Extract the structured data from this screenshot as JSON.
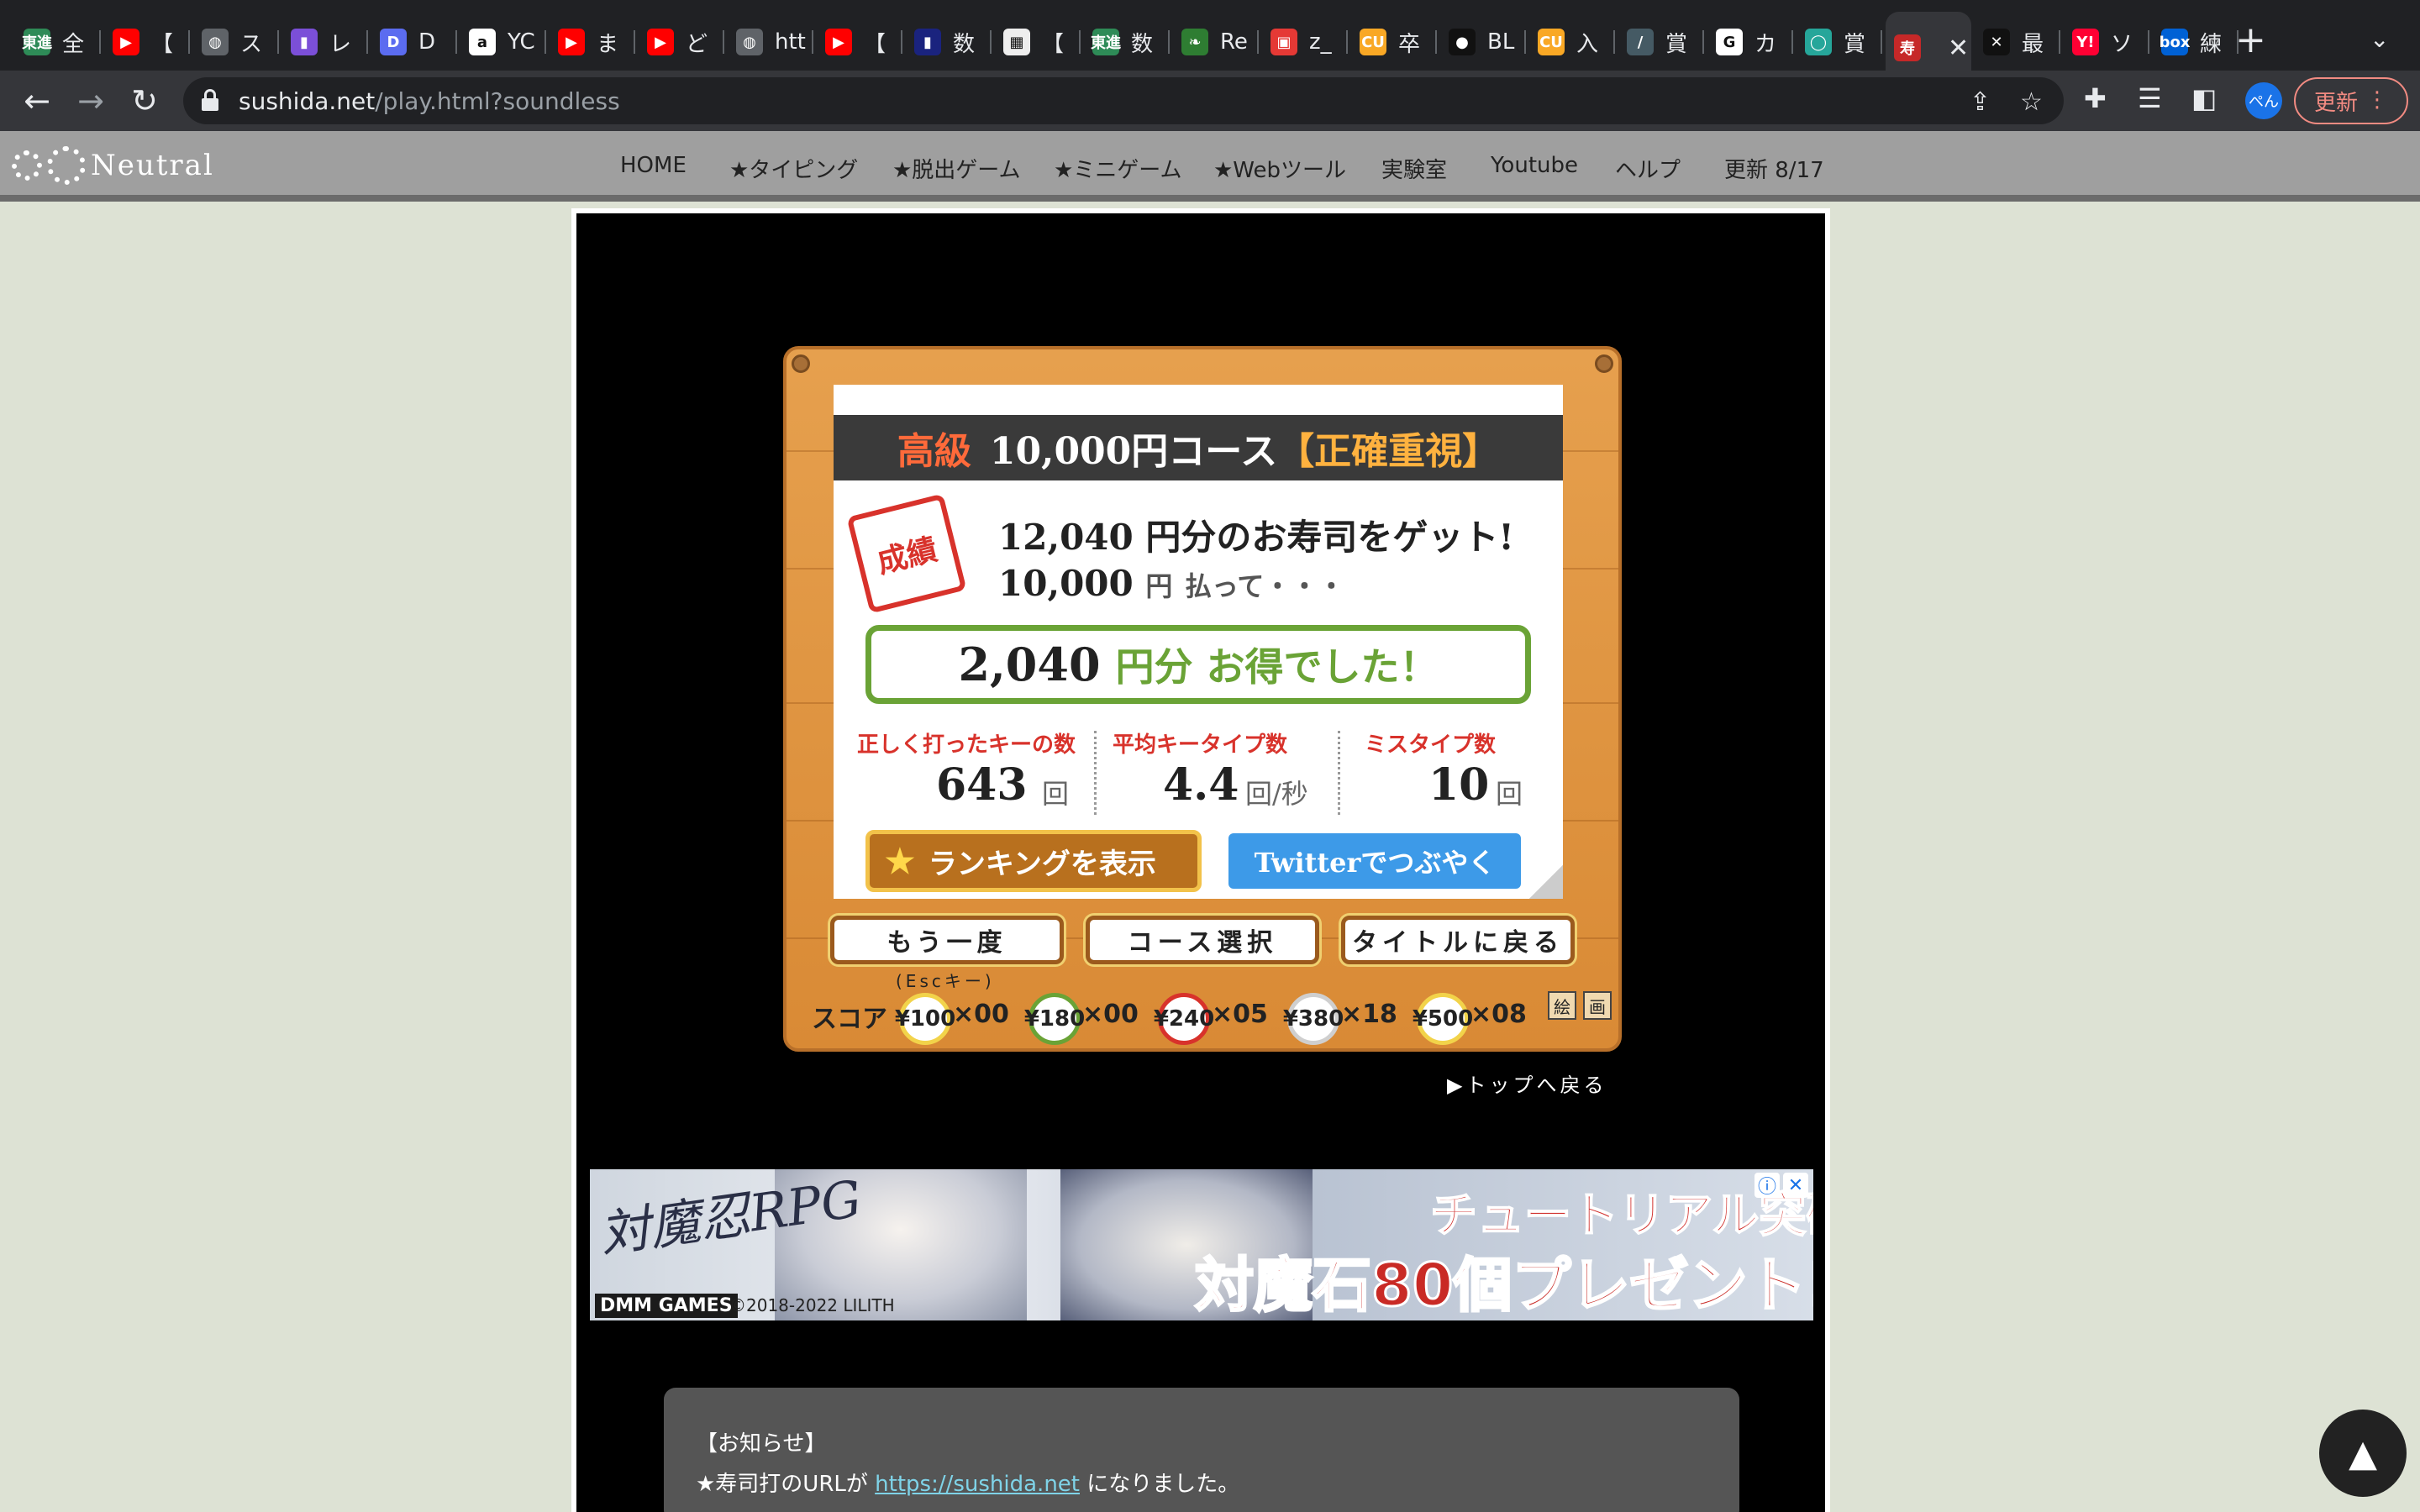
{
  "browser": {
    "tabs": [
      {
        "label": "全",
        "fav_text": "東進",
        "fav_color": "#2e8b57"
      },
      {
        "label": "【",
        "fav_text": "▶",
        "fav_color": "#ff0000"
      },
      {
        "label": "ス",
        "fav_text": "◍",
        "fav_color": "#5f6368"
      },
      {
        "label": "レ",
        "fav_text": "▮",
        "fav_color": "#7b4fd8"
      },
      {
        "label": "D",
        "fav_text": "D",
        "fav_color": "#5b6cf0"
      },
      {
        "label": "YC",
        "fav_text": "a",
        "fav_color": "#ffffff"
      },
      {
        "label": "ま",
        "fav_text": "▶",
        "fav_color": "#ff0000"
      },
      {
        "label": "ど",
        "fav_text": "▶",
        "fav_color": "#ff0000"
      },
      {
        "label": "htt",
        "fav_text": "◍",
        "fav_color": "#5f6368"
      },
      {
        "label": "【",
        "fav_text": "▶",
        "fav_color": "#ff0000"
      },
      {
        "label": "数",
        "fav_text": "▮",
        "fav_color": "#1a237e"
      },
      {
        "label": "【",
        "fav_text": "▦",
        "fav_color": "#eeeeee"
      },
      {
        "label": "数",
        "fav_text": "東進",
        "fav_color": "#2e8b57"
      },
      {
        "label": "Re",
        "fav_text": "❧",
        "fav_color": "#2e7d32"
      },
      {
        "label": "z_",
        "fav_text": "▣",
        "fav_color": "#e53935"
      },
      {
        "label": "卒",
        "fav_text": "CU",
        "fav_color": "#f9a825"
      },
      {
        "label": "BL",
        "fav_text": "●",
        "fav_color": "#111111"
      },
      {
        "label": "入",
        "fav_text": "CU",
        "fav_color": "#f9a825"
      },
      {
        "label": "賞",
        "fav_text": "/",
        "fav_color": "#455a64"
      },
      {
        "label": "カ",
        "fav_text": "G",
        "fav_color": "#ffffff"
      },
      {
        "label": "賞",
        "fav_text": "◯",
        "fav_color": "#26a69a"
      },
      {
        "label": "",
        "fav_text": "寿",
        "fav_color": "#c62828",
        "active": true
      },
      {
        "label": "最",
        "fav_text": "✕",
        "fav_color": "#111111"
      },
      {
        "label": "ソ",
        "fav_text": "Y!",
        "fav_color": "#ff0033"
      },
      {
        "label": "練",
        "fav_text": "box",
        "fav_color": "#0061d5"
      }
    ],
    "url_host": "sushida.net",
    "url_path": "/play.html?soundless",
    "avatar_text": "ぺん",
    "update_label": "更新"
  },
  "site_nav": {
    "logo_text": "Neutral",
    "links": [
      "HOME",
      "★タイピング",
      "★脱出ゲーム",
      "★ミニゲーム",
      "★Webツール",
      "実験室",
      "Youtube",
      "ヘルプ",
      "更新 8/17"
    ]
  },
  "result": {
    "course_grade": "高級",
    "course_name": "10,000円コース",
    "course_mode": "【正確重視】",
    "stamp": "成績",
    "earned_amount": "12,040",
    "earned_text": "円分のお寿司をゲット!",
    "paid_amount": "10,000",
    "paid_unit": "円",
    "paid_text": "払って・・・",
    "gain_amount": "2,040",
    "gain_text": "円分 お得でした！",
    "stats": [
      {
        "label": "正しく打ったキーの数",
        "value": "643",
        "unit": "回"
      },
      {
        "label": "平均キータイプ数",
        "value": "4.4",
        "unit": "回/秒"
      },
      {
        "label": "ミスタイプ数",
        "value": "10",
        "unit": "回"
      }
    ],
    "ranking_button": "ランキングを表示",
    "twitter_button": "Twitterでつぶやく",
    "buttons": [
      "もう一度",
      "コース選択",
      "タイトルに戻る"
    ],
    "esc_hint": "(Escキー)",
    "score_label": "スコア",
    "plates": [
      {
        "price": "¥100",
        "count": "×00",
        "color": "#f2d34a"
      },
      {
        "price": "¥180",
        "count": "×00",
        "color": "#6aa336"
      },
      {
        "price": "¥240",
        "count": "×05",
        "color": "#d8322b"
      },
      {
        "price": "¥380",
        "count": "×18",
        "color": "#cfcfcf"
      },
      {
        "price": "¥500",
        "count": "×08",
        "color": "#f2d34a"
      }
    ],
    "mini_icons": [
      "絵",
      "画"
    ],
    "back_to_top": "▶トップへ戻る"
  },
  "ad": {
    "logo": "対魔忍RPG",
    "headline1": "チュートリアル突破で",
    "headline2": "対魔石80個プレゼント!!",
    "brand": "DMM GAMES",
    "copyright": "©2018-2022 LILITH"
  },
  "notice": {
    "title": "【お知らせ】",
    "text_before": "★寿司打のURLが ",
    "link": "https://sushida.net",
    "text_after": " になりました。"
  },
  "scroll_top_icon": "▲"
}
